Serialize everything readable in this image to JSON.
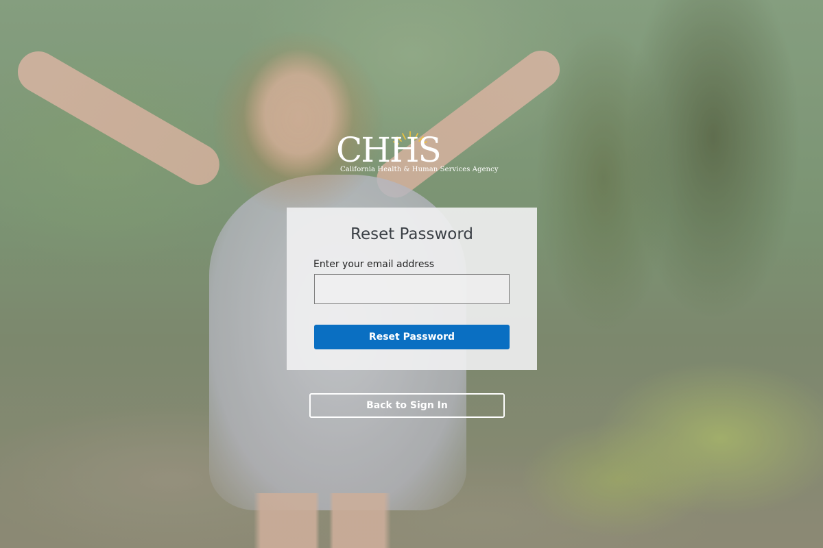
{
  "logo": {
    "wordmark": "CHHS",
    "subtitle": "California Health & Human Services Agency"
  },
  "reset_card": {
    "title": "Reset Password",
    "email_label": "Enter your email address",
    "email_value": "",
    "email_placeholder": "",
    "submit_label": "Reset Password"
  },
  "back_link": {
    "label": "Back to Sign In"
  },
  "colors": {
    "primary_button": "#0a6fc2",
    "card_background": "#f1f1f2",
    "title_text": "#3a3f45"
  }
}
